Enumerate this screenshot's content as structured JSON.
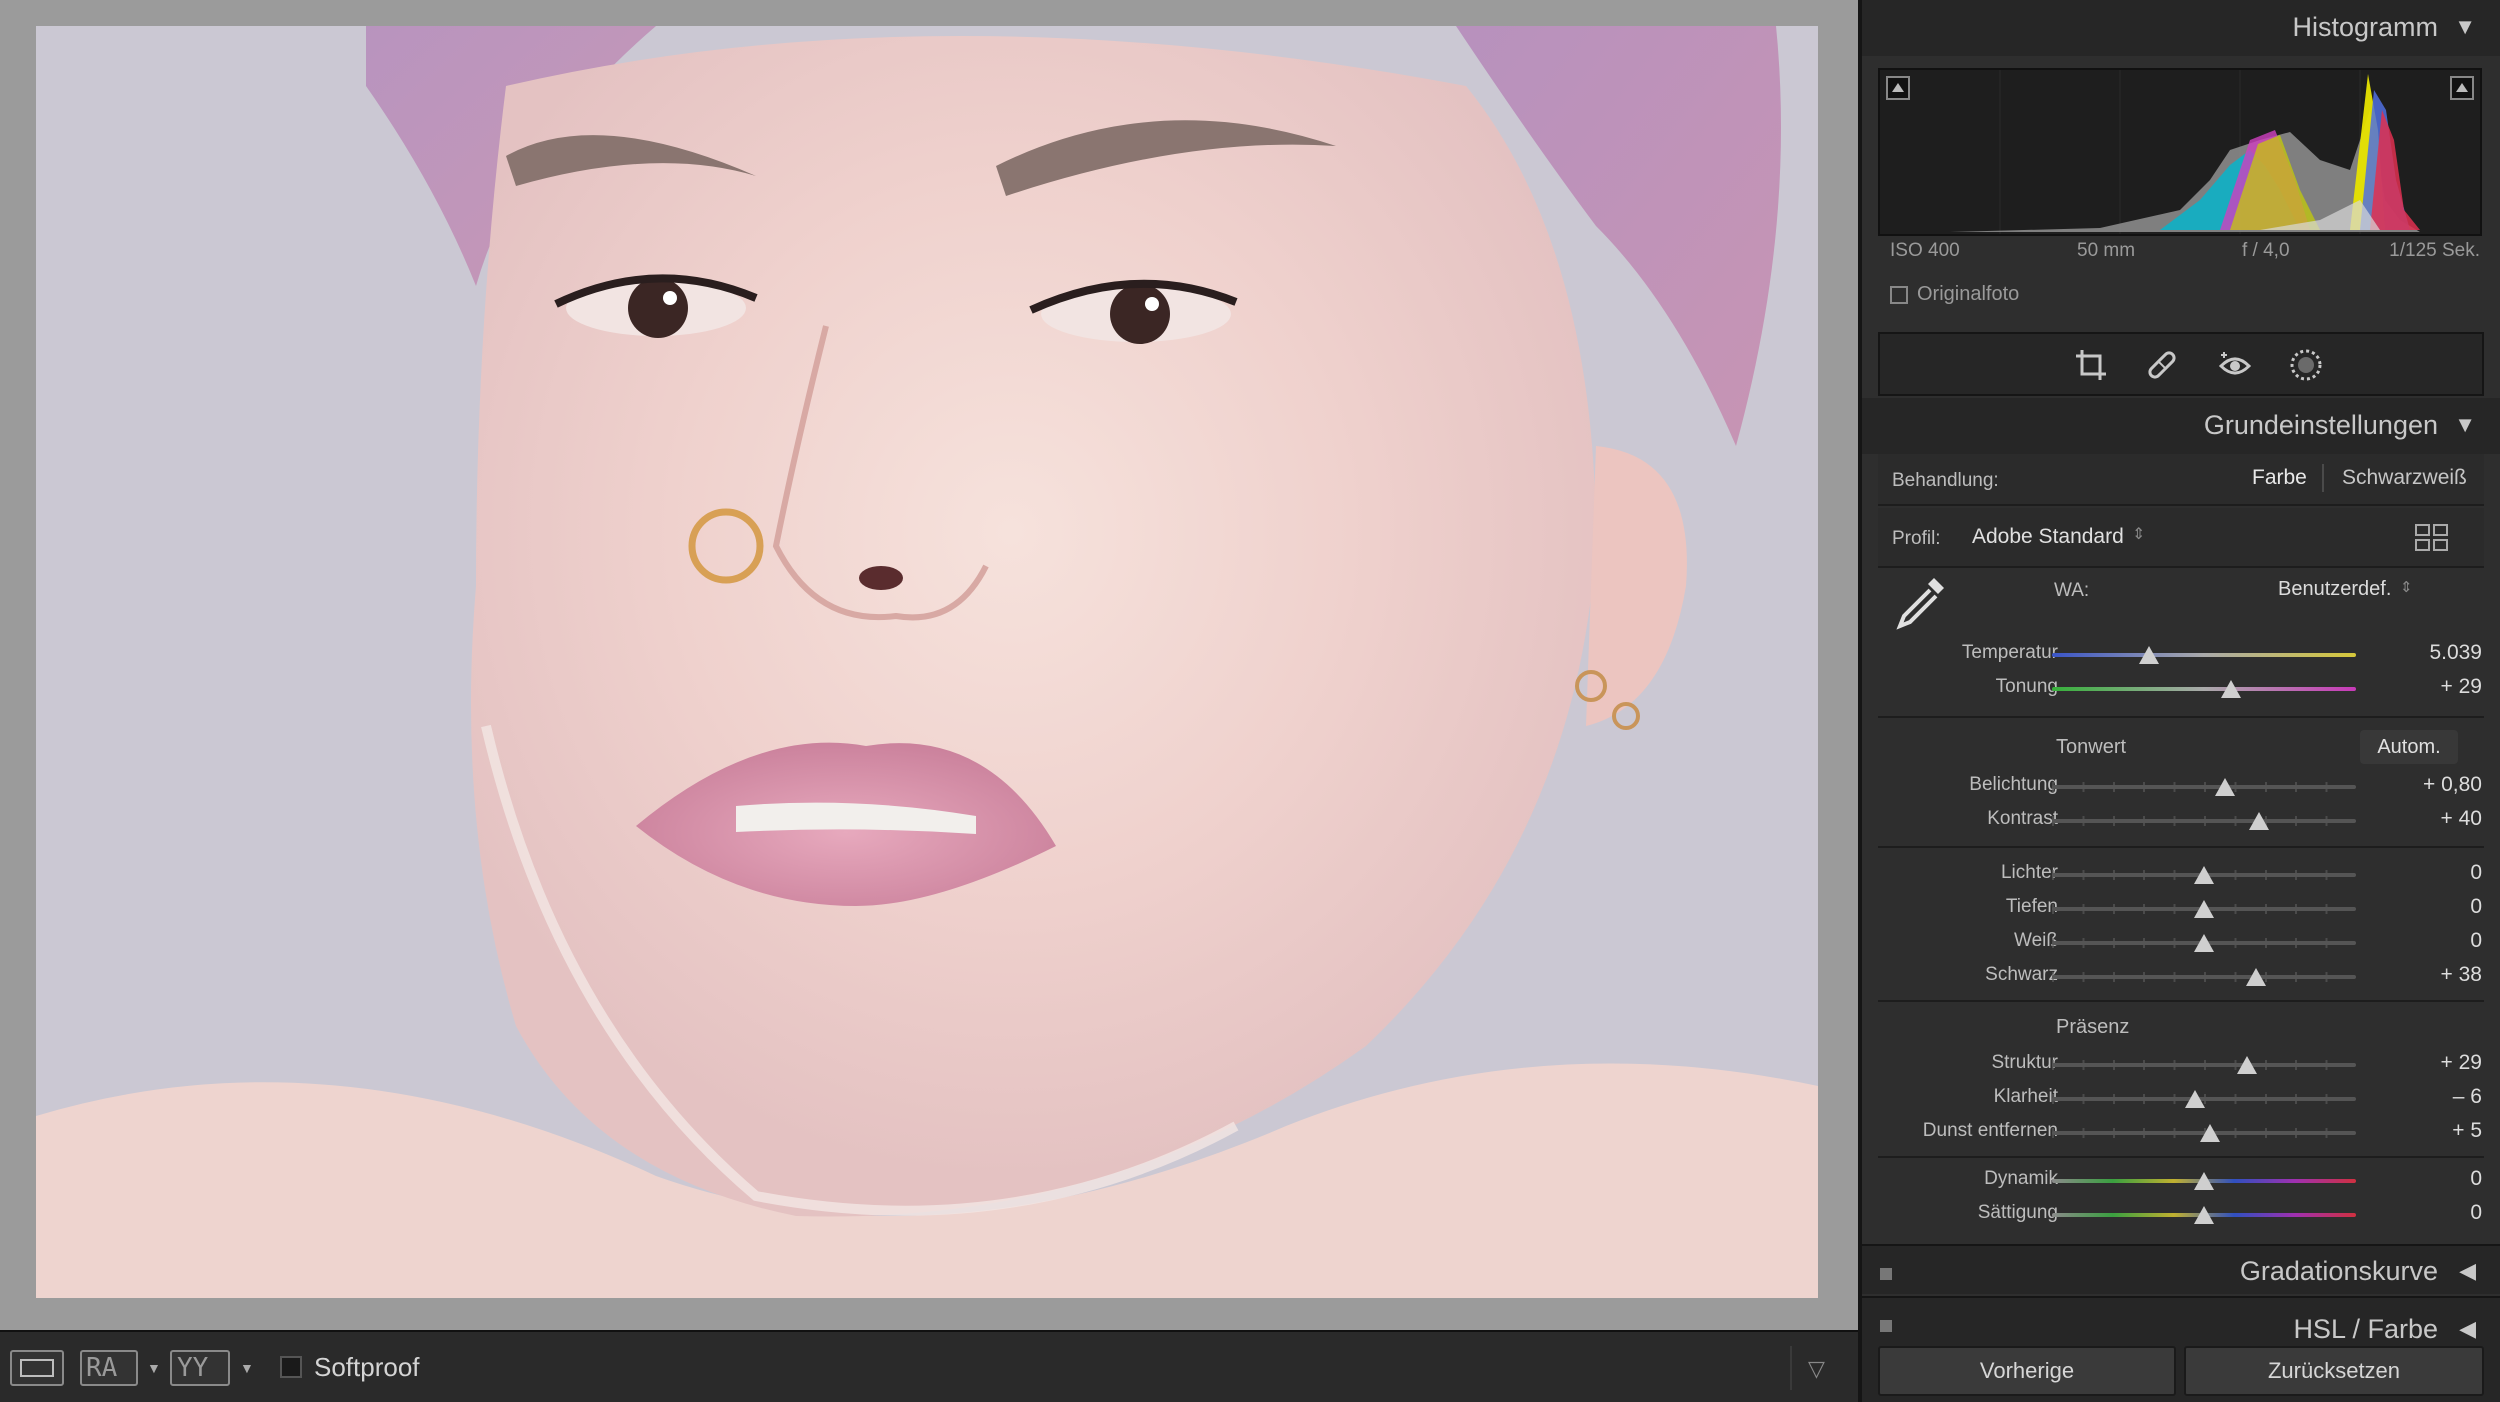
{
  "viewer": {
    "photo_subject": "portrait"
  },
  "toolbar": {
    "softproof_label": "Softproof",
    "compare_ra": "RA",
    "compare_yy": "YY"
  },
  "panel": {
    "histogram": {
      "title": "Histogramm",
      "iso": "ISO 400",
      "focal": "50 mm",
      "aperture": "f / 4,0",
      "shutter": "1/125 Sek.",
      "original_label": "Originalfoto"
    },
    "basic": {
      "title": "Grundeinstellungen",
      "treatment_label": "Behandlung:",
      "treatment_color": "Farbe",
      "treatment_bw": "Schwarzweiß",
      "profile_label": "Profil:",
      "profile_value": "Adobe Standard",
      "wb_label": "WA:",
      "wb_value": "Benutzerdef.",
      "tone_label": "Tonwert",
      "auto_label": "Autom.",
      "presence_label": "Präsenz",
      "sliders": {
        "temperatur": {
          "label": "Temperatur",
          "value": "5.039",
          "pos": 0.32
        },
        "tonung": {
          "label": "Tonung",
          "value": "+ 29",
          "pos": 0.59
        },
        "belichtung": {
          "label": "Belichtung",
          "value": "+ 0,80",
          "pos": 0.57
        },
        "kontrast": {
          "label": "Kontrast",
          "value": "+ 40",
          "pos": 0.68
        },
        "lichter": {
          "label": "Lichter",
          "value": "0",
          "pos": 0.5
        },
        "tiefen": {
          "label": "Tiefen",
          "value": "0",
          "pos": 0.5
        },
        "weiss": {
          "label": "Weiß",
          "value": "0",
          "pos": 0.5
        },
        "schwarz": {
          "label": "Schwarz",
          "value": "+ 38",
          "pos": 0.67
        },
        "struktur": {
          "label": "Struktur",
          "value": "+ 29",
          "pos": 0.64
        },
        "klarheit": {
          "label": "Klarheit",
          "value": "– 6",
          "pos": 0.47
        },
        "dunst": {
          "label": "Dunst entfernen",
          "value": "+ 5",
          "pos": 0.52
        },
        "dynamik": {
          "label": "Dynamik",
          "value": "0",
          "pos": 0.5
        },
        "saettigung": {
          "label": "Sättigung",
          "value": "0",
          "pos": 0.5
        }
      }
    },
    "gradation": {
      "title": "Gradationskurve"
    },
    "hsl": {
      "title": "HSL / Farbe"
    },
    "buttons": {
      "previous": "Vorherige",
      "reset": "Zurücksetzen"
    }
  }
}
